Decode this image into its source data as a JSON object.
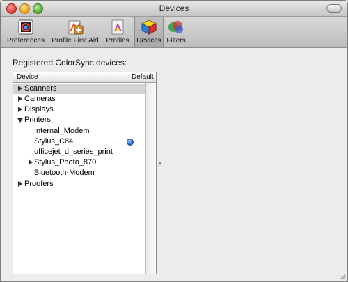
{
  "window": {
    "title": "Devices"
  },
  "toolbar": {
    "items": [
      {
        "label": "Preferences",
        "icon": "preferences-icon"
      },
      {
        "label": "Profile First Aid",
        "icon": "profile-first-aid-icon"
      },
      {
        "label": "Profiles",
        "icon": "profiles-icon"
      },
      {
        "label": "Devices",
        "icon": "devices-icon",
        "active": true
      },
      {
        "label": "Filters",
        "icon": "filters-icon"
      }
    ]
  },
  "devices": {
    "section_label": "Registered ColorSync devices:",
    "columns": {
      "device": "Device",
      "default": "Default"
    },
    "rows": [
      {
        "label": "Scanners",
        "level": 0,
        "disclosure": "collapsed",
        "selected": true
      },
      {
        "label": "Cameras",
        "level": 0,
        "disclosure": "collapsed"
      },
      {
        "label": "Displays",
        "level": 0,
        "disclosure": "collapsed"
      },
      {
        "label": "Printers",
        "level": 0,
        "disclosure": "expanded"
      },
      {
        "label": "Internal_Modem",
        "level": 1
      },
      {
        "label": "Stylus_C84",
        "level": 1,
        "is_default": true
      },
      {
        "label": "officejet_d_series_print",
        "level": 1
      },
      {
        "label": "Stylus_Photo_870",
        "level": 1,
        "disclosure": "collapsed"
      },
      {
        "label": "Bluetooth-Modem",
        "level": 1
      },
      {
        "label": "Proofers",
        "level": 0,
        "disclosure": "collapsed"
      }
    ]
  },
  "colors": {
    "selection": "#d4d4d4",
    "default_dot": "#1f66c7"
  }
}
